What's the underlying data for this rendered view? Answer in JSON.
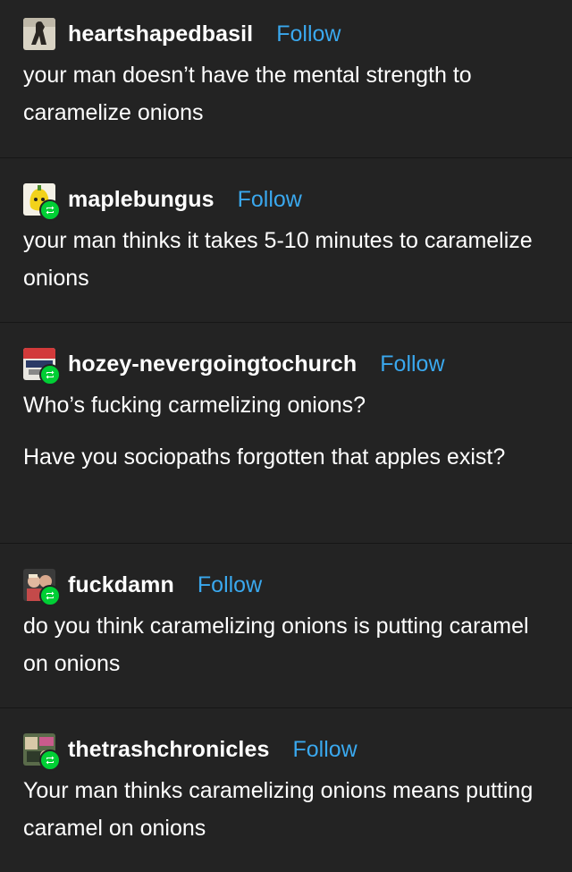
{
  "theme": {
    "background": "#232323",
    "divider": "#161616",
    "text": "#ffffff",
    "follow_color": "#3aa8ee",
    "reblog_badge": "#00cf35"
  },
  "posts": [
    {
      "username": "heartshapedbasil",
      "follow_label": "Follow",
      "reblog": false,
      "avatar": "heartshapedbasil-avatar",
      "paragraphs": [
        "your man doesn’t have the mental strength to caramelize onions"
      ]
    },
    {
      "username": "maplebungus",
      "follow_label": "Follow",
      "reblog": true,
      "avatar": "maplebungus-avatar",
      "paragraphs": [
        "your man thinks it takes 5-10 minutes to caramelize onions"
      ]
    },
    {
      "username": "hozey-nevergoingtochurch",
      "follow_label": "Follow",
      "reblog": true,
      "avatar": "hozey-avatar",
      "paragraphs": [
        "Who’s fucking carmelizing onions?",
        "Have you sociopaths forgotten that apples exist?"
      ]
    },
    {
      "username": "fuckdamn",
      "follow_label": "Follow",
      "reblog": true,
      "avatar": "fuckdamn-avatar",
      "paragraphs": [
        "do you think caramelizing onions is putting caramel on onions"
      ]
    },
    {
      "username": "thetrashchronicles",
      "follow_label": "Follow",
      "reblog": true,
      "avatar": "thetrashchronicles-avatar",
      "paragraphs": [
        "Your man thinks caramelizing onions means putting caramel on onions"
      ]
    }
  ]
}
